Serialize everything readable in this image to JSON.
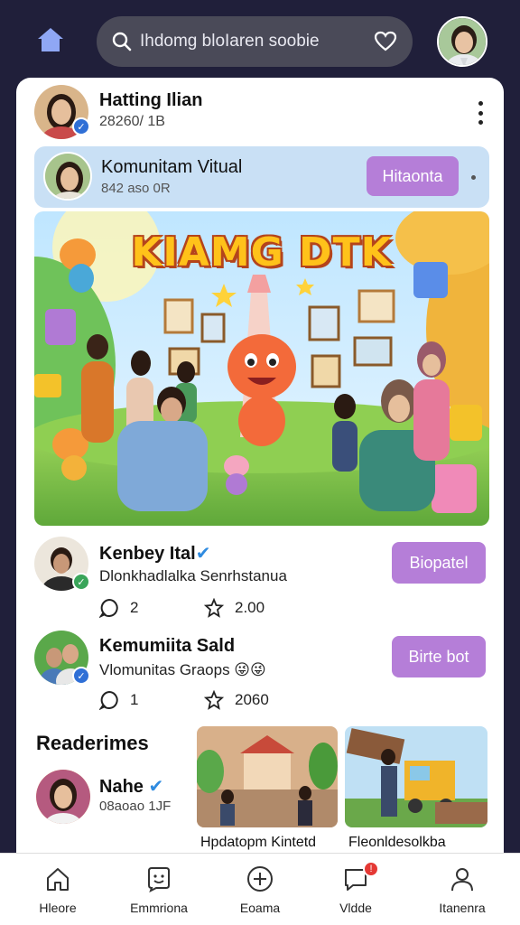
{
  "colors": {
    "background": "#201f3a",
    "search_bg": "#4a4a58",
    "accent_button": "#b57ed8",
    "community_bg": "#c9e0f5",
    "verified_blue": "#2f6fd6",
    "verified_green": "#3aa55a",
    "notification_red": "#e53935"
  },
  "topbar": {
    "home_icon": "home-icon",
    "search_text": "Ihdomg bloIaren soobie",
    "heart_icon": "heart-icon"
  },
  "header_post": {
    "name": "Hatting Ilian",
    "meta": "28260/ 1B"
  },
  "community": {
    "name": "Komunitam Vitual",
    "meta": "842 aso 0R",
    "button": "Hitaonta"
  },
  "hero": {
    "title": "KIAMG DTK"
  },
  "posts": [
    {
      "name": "Kenbey Ital",
      "text": "Dlonkhadlalka Senrhstanua",
      "comments": "2",
      "likes": "2.00",
      "button": "Biopatel"
    },
    {
      "name": "Kemumiita Sald",
      "text": "Vlomunitas Graops 😜😜",
      "comments": "1",
      "likes": "2060",
      "button": "Birte bot"
    }
  ],
  "recommendations": {
    "title": "Readerimes",
    "person_name": "Nahe",
    "person_meta": "08aoao 1JF",
    "thumbs": [
      {
        "caption": "Hpdatopm Kintetd"
      },
      {
        "caption": "Fleonldesolkba"
      }
    ]
  },
  "bottom_nav": [
    {
      "label": "Hleore",
      "icon": "home-icon"
    },
    {
      "label": "Emmriona",
      "icon": "chat-face-icon"
    },
    {
      "label": "Eoama",
      "icon": "plus-circle-icon"
    },
    {
      "label": "Vldde",
      "icon": "message-icon",
      "badge": "!"
    },
    {
      "label": "Itanenra",
      "icon": "person-icon"
    }
  ]
}
